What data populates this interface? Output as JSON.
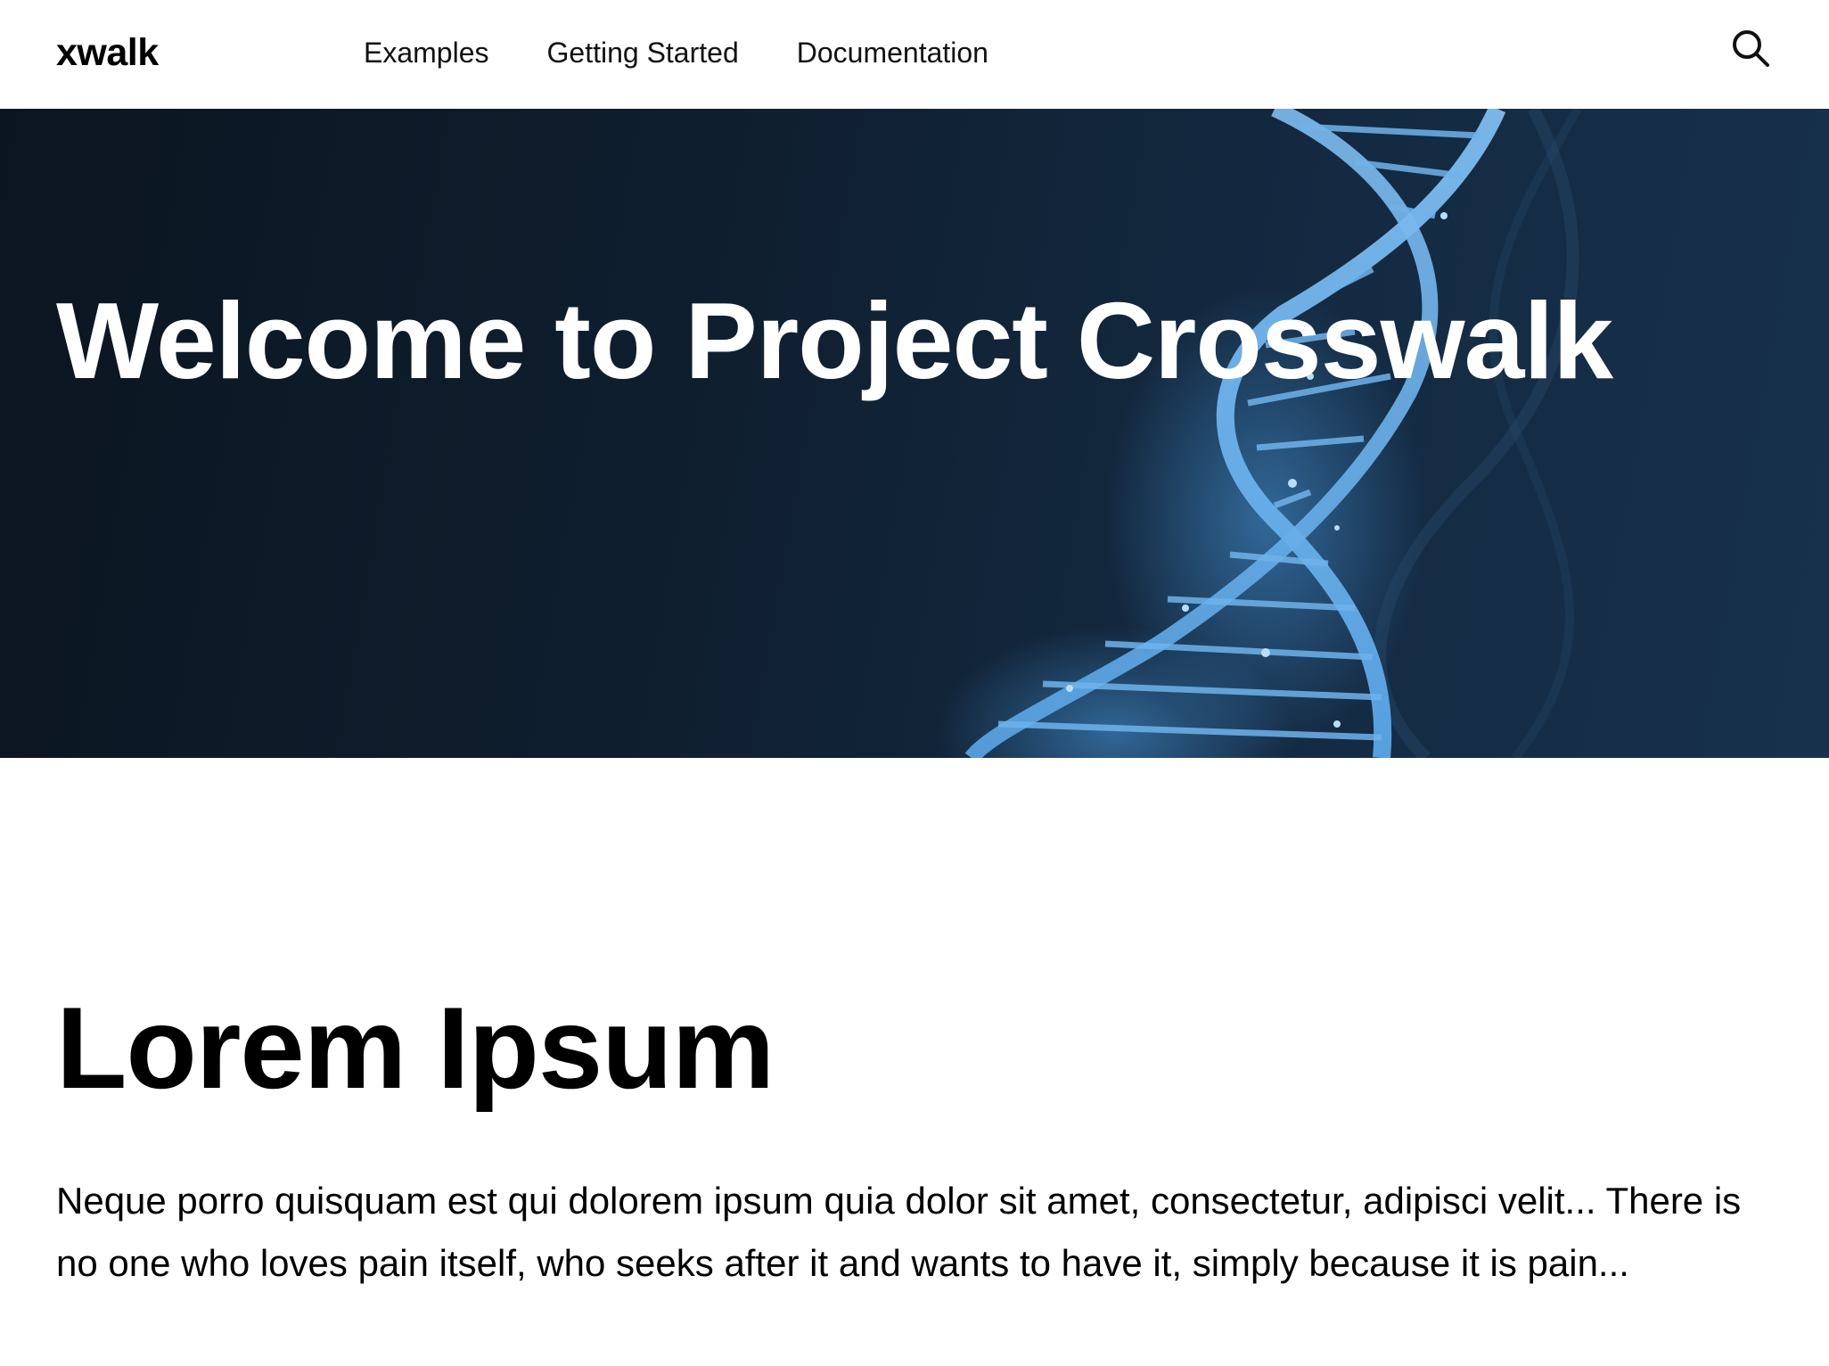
{
  "header": {
    "logo": "xwalk",
    "nav": [
      {
        "label": "Examples"
      },
      {
        "label": "Getting Started"
      },
      {
        "label": "Documentation"
      }
    ],
    "search_icon": "search-icon"
  },
  "hero": {
    "title": "Welcome to Project Crosswalk",
    "background_image": "dna-helix"
  },
  "main": {
    "title": "Lorem Ipsum",
    "body": "Neque porro quisquam est qui dolorem ipsum quia dolor sit amet, consectetur, adipisci velit... There is no one who loves pain itself, who seeks after it and wants to have it, simply because it is pain..."
  },
  "colors": {
    "hero_bg_dark": "#0b1520",
    "hero_bg_light": "#17304c",
    "helix_blue": "#5aa6e6",
    "text": "#000000"
  }
}
